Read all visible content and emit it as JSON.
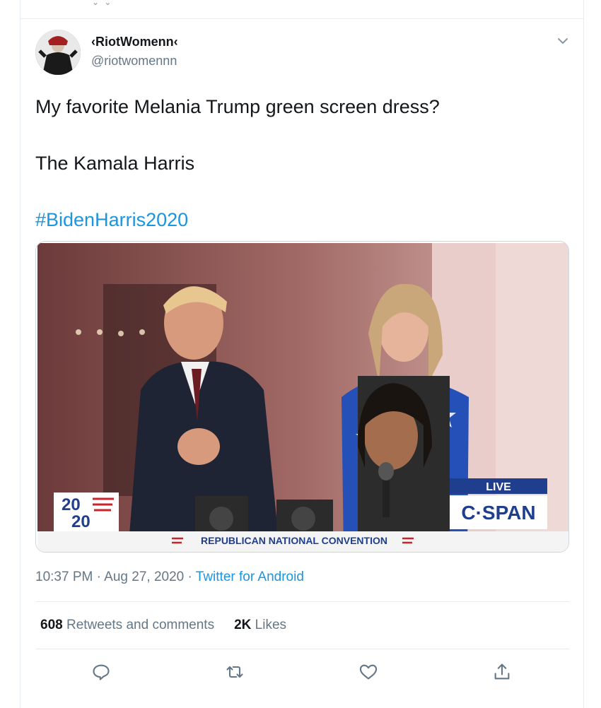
{
  "tweet": {
    "display_name": "‹RiotWomenn‹",
    "handle": "@riotwomennn",
    "text_line1": "My favorite Melania Trump green screen dress?",
    "text_line2": "The Kamala Harris",
    "hashtag": "#BidenHarris2020",
    "time": "10:37 PM",
    "date": "Aug 27, 2020",
    "source": "Twitter for Android",
    "retweets_count": "608",
    "retweets_label": "Retweets and comments",
    "likes_count": "2K",
    "likes_label": "Likes"
  },
  "media": {
    "live_label": "LIVE",
    "network_label": "C·SPAN",
    "convention_label": "REPUBLICAN NATIONAL CONVENTION",
    "year_top": "20",
    "year_bottom": "20"
  },
  "colors": {
    "link": "#1b95e0",
    "secondary_text": "#657786",
    "border": "#e6ecf0"
  },
  "icons": [
    "chevron-down-icon",
    "reply-icon",
    "retweet-icon",
    "like-icon",
    "share-icon"
  ]
}
